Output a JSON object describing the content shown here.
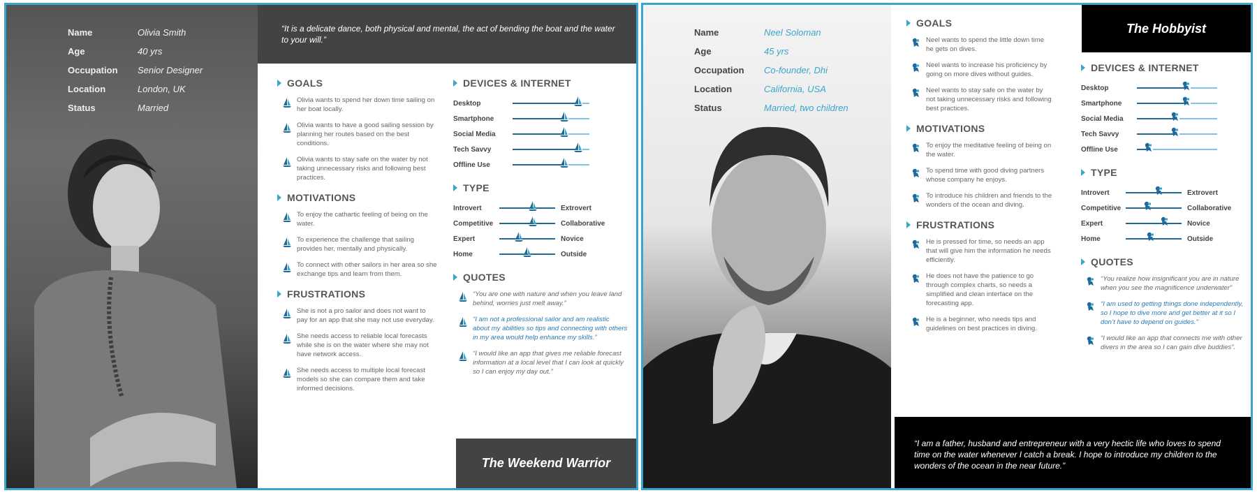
{
  "colors": {
    "accent": "#3aa6cc",
    "dark": "#434343",
    "black": "#000000"
  },
  "personas": [
    {
      "quote": "“It is a delicate dance, both physical and mental, the act of bending the boat and the water to your will.”",
      "title": "The Weekend Warrior",
      "icon": "sailboat-icon",
      "info": [
        {
          "label": "Name",
          "value": "Olivia Smith"
        },
        {
          "label": "Age",
          "value": "40 yrs"
        },
        {
          "label": "Occupation",
          "value": "Senior Designer"
        },
        {
          "label": "Location",
          "value": "London, UK"
        },
        {
          "label": "Status",
          "value": "Married"
        }
      ],
      "goals": {
        "heading": "GOALS",
        "items": [
          "Olivia wants to spend her down time sailing on her boat locally.",
          "Olivia wants to have a good sailing session by planning her routes based on the best conditions.",
          "Olivia wants to stay safe on the water by not taking unnecessary risks and following best practices."
        ]
      },
      "motivations": {
        "heading": "MOTIVATIONS",
        "items": [
          "To enjoy the cathartic feeling of being on the water.",
          "To experience the challenge that sailing provides her, mentally and physically.",
          "To connect with other sailors in her area so she exchange tips and learn from them."
        ]
      },
      "frustrations": {
        "heading": "FRUSTRATIONS",
        "items": [
          "She is not a pro sailor and does not want to pay for an app that she may not use everyday.",
          "She needs access to reliable local forecasts while she is on the water where she may not have network access.",
          "She needs access to multiple local forecast models so she can compare them and take informed decisions."
        ]
      },
      "devices": {
        "heading": "DEVICES & INTERNET",
        "items": [
          {
            "label": "Desktop",
            "level": 0.85
          },
          {
            "label": "Smartphone",
            "level": 0.67
          },
          {
            "label": "Social Media",
            "level": 0.67
          },
          {
            "label": "Tech Savvy",
            "level": 0.85
          },
          {
            "label": "Offline Use",
            "level": 0.67
          }
        ]
      },
      "type": {
        "heading": "TYPE",
        "items": [
          {
            "left": "Introvert",
            "right": "Extrovert",
            "level": 0.6
          },
          {
            "left": "Competitive",
            "right": "Collaborative",
            "level": 0.6
          },
          {
            "left": "Expert",
            "right": "Novice",
            "level": 0.35
          },
          {
            "left": "Home",
            "right": "Outside",
            "level": 0.5
          }
        ]
      },
      "quotes": {
        "heading": "QUOTES",
        "items": [
          "“You are one with nature and when you leave land behind, worries just melt away.”",
          "“I am not a professional sailor and am realistic about my abilities so tips and connecting with others in my area would help enhance my skills.”",
          "“I would like an app that gives me reliable forecast information at a local level that I can look at quickly so I can enjoy my day out.”"
        ]
      }
    },
    {
      "quote": "“I am a father, husband and entrepreneur with a very hectic life who loves to spend time on the water whenever I catch a break. I hope to introduce my children to the wonders of the ocean in the near future.”",
      "title": "The Hobbyist",
      "icon": "diver-icon",
      "info": [
        {
          "label": "Name",
          "value": "Neel Soloman"
        },
        {
          "label": "Age",
          "value": "45 yrs"
        },
        {
          "label": "Occupation",
          "value": "Co-founder, Dhi"
        },
        {
          "label": "Location",
          "value": "California, USA"
        },
        {
          "label": "Status",
          "value": "Married, two children"
        }
      ],
      "goals": {
        "heading": "GOALS",
        "items": [
          "Neel wants to spend the little down time he gets on dives.",
          "Neel wants to increase his proficiency by going on more dives without guides.",
          "Neel wants to stay safe on the water by not taking unnecessary risks and following best practices."
        ]
      },
      "motivations": {
        "heading": "MOTIVATIONS",
        "items": [
          "To enjoy the meditative feeling of being on the water.",
          "To spend time with good diving partners whose company he enjoys.",
          "To introduce his children and friends to the wonders of the ocean and diving."
        ]
      },
      "frustrations": {
        "heading": "FRUSTRATIONS",
        "items": [
          "He is pressed for time, so needs an app that will give him the information he needs efficiently.",
          "He does not have the patience to go through complex charts, so needs a simplified and clean interface on the forecasting app.",
          "He is a beginner, who needs tips and guidelines on best practices in diving."
        ]
      },
      "devices": {
        "heading": "DEVICES & INTERNET",
        "items": [
          {
            "label": "Desktop",
            "level": 0.62
          },
          {
            "label": "Smartphone",
            "level": 0.62
          },
          {
            "label": "Social Media",
            "level": 0.48
          },
          {
            "label": "Tech Savvy",
            "level": 0.48
          },
          {
            "label": "Offline Use",
            "level": 0.15
          }
        ]
      },
      "type": {
        "heading": "TYPE",
        "items": [
          {
            "left": "Introvert",
            "right": "Extrovert",
            "level": 0.6
          },
          {
            "left": "Competitive",
            "right": "Collaborative",
            "level": 0.4
          },
          {
            "left": "Expert",
            "right": "Novice",
            "level": 0.7
          },
          {
            "left": "Home",
            "right": "Outside",
            "level": 0.45
          }
        ]
      },
      "quotes": {
        "heading": "QUOTES",
        "items": [
          "“You realize how insignificant you are in nature when you see the magnificence underwater”",
          "“I am used to getting things done independently, so I hope to dive more and get better at it so I don’t have to depend on guides.”",
          "“I would like an app that connects me with other divers in the area so I can gain dive buddies”."
        ]
      }
    }
  ]
}
